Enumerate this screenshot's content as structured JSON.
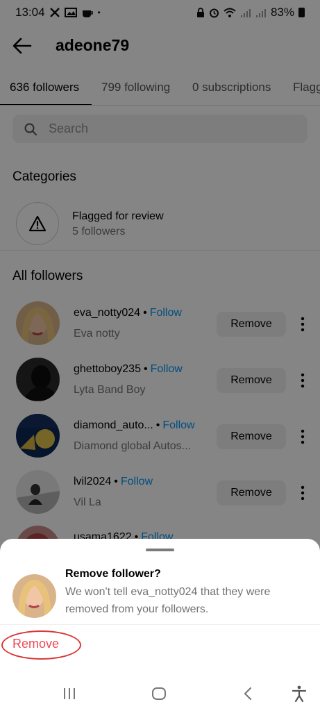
{
  "status_bar": {
    "time": "13:04",
    "left_icons": [
      "x-icon",
      "gallery-icon",
      "cup-icon"
    ],
    "dot": "•",
    "battery": "83%"
  },
  "header": {
    "title": "adeone79"
  },
  "tabs": [
    {
      "label": "636 followers",
      "active": true
    },
    {
      "label": "799 following",
      "active": false
    },
    {
      "label": "0 subscriptions",
      "active": false
    },
    {
      "label": "Flagg",
      "active": false
    }
  ],
  "search": {
    "placeholder": "Search"
  },
  "categories": {
    "title": "Categories",
    "items": [
      {
        "title": "Flagged for review",
        "subtitle": "5 followers",
        "icon": "warning-icon"
      }
    ]
  },
  "followers": {
    "title": "All followers",
    "follow_label": "Follow",
    "dot": "•",
    "remove_label": "Remove",
    "items": [
      {
        "username": "eva_notty024",
        "name": "Eva notty"
      },
      {
        "username": "ghettoboy235",
        "name": "Lyta Band Boy"
      },
      {
        "username": "diamond_auto...",
        "name": "Diamond global Autos..."
      },
      {
        "username": "lvil2024",
        "name": "Vil La"
      },
      {
        "username": "usama1622",
        "name": ""
      }
    ]
  },
  "sheet": {
    "title": "Remove follower?",
    "body": "We won't tell eva_notty024 that they were removed from your followers.",
    "remove_label": "Remove"
  },
  "colors": {
    "accent": "#0095f6",
    "danger": "#ed4956",
    "annotation": "#d93838"
  }
}
